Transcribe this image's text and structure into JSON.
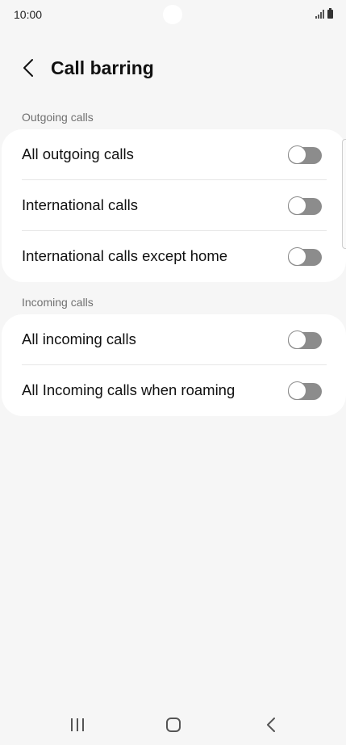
{
  "status_bar": {
    "time": "10:00"
  },
  "header": {
    "title": "Call barring",
    "back_icon": "chevron-left-icon"
  },
  "sections": [
    {
      "label": "Outgoing calls",
      "items": [
        {
          "label": "All outgoing calls",
          "enabled": false
        },
        {
          "label": "International calls",
          "enabled": false
        },
        {
          "label": "International calls except home",
          "enabled": false
        }
      ]
    },
    {
      "label": "Incoming calls",
      "items": [
        {
          "label": "All incoming calls",
          "enabled": false
        },
        {
          "label": "All Incoming calls when roaming",
          "enabled": false
        }
      ]
    }
  ],
  "nav_bar": {
    "recents_icon": "recents-icon",
    "home_icon": "home-icon",
    "back_icon": "back-icon"
  },
  "colors": {
    "background": "#f6f6f6",
    "card": "#ffffff",
    "toggle_off": "#8c8c8c",
    "section_label": "#707070"
  }
}
